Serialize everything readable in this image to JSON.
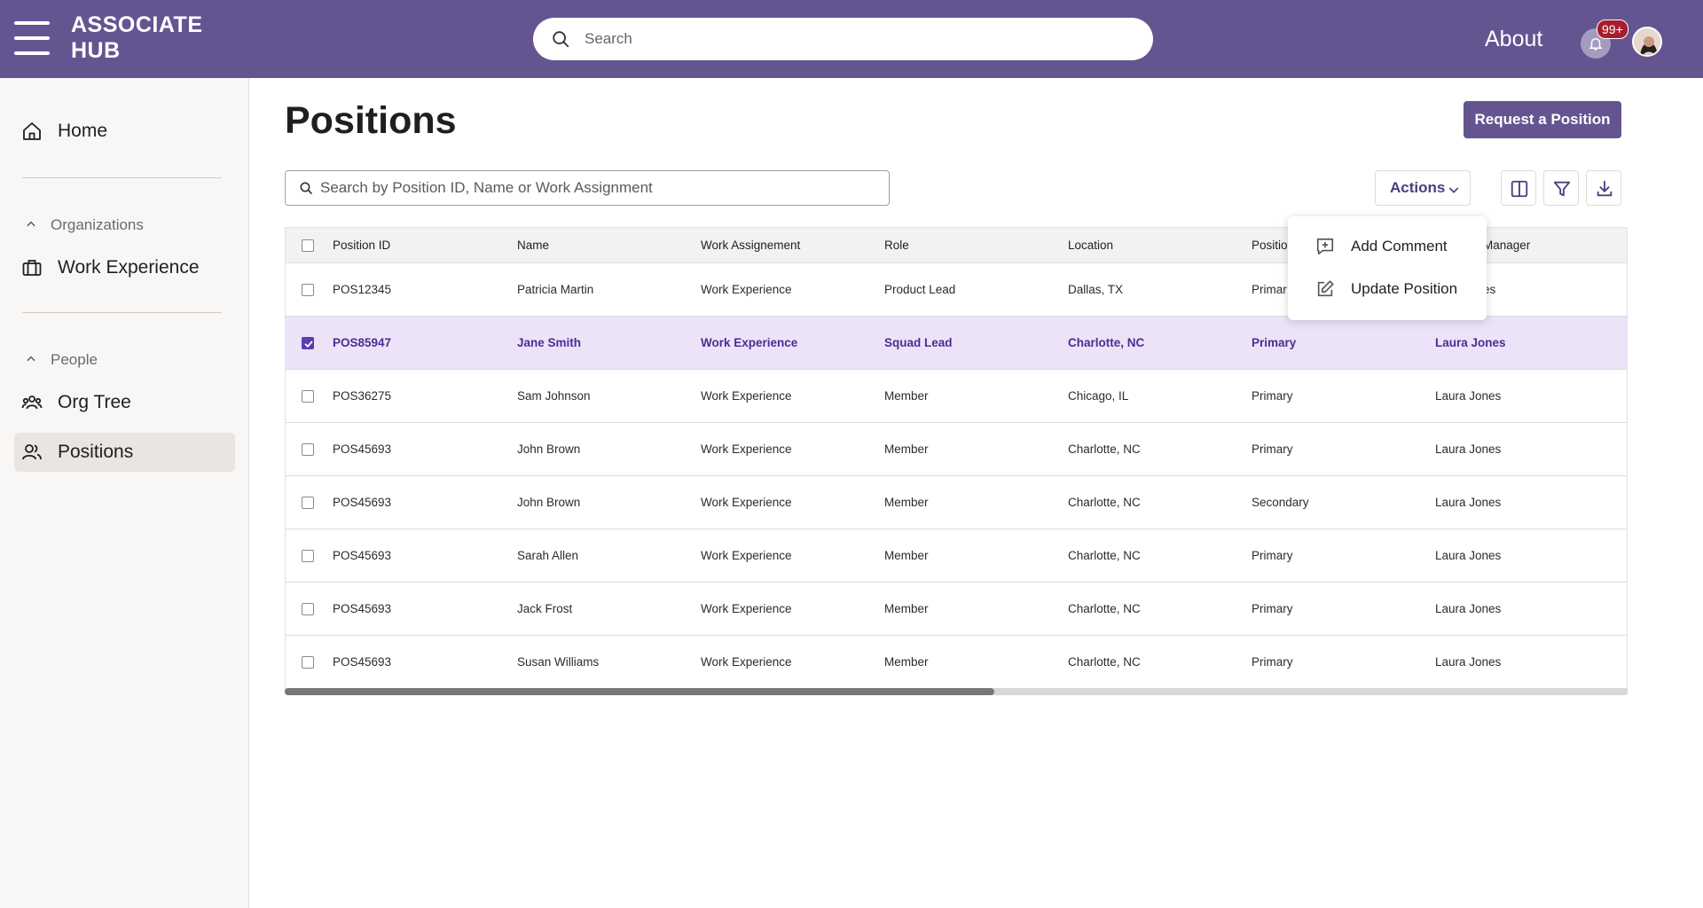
{
  "header": {
    "brand_line1": "ASSOCIATE",
    "brand_line2": "HUB",
    "search_placeholder": "Search",
    "about_label": "About",
    "notification_count": "99+"
  },
  "sidebar": {
    "home_label": "Home",
    "section_organizations": "Organizations",
    "work_experience_label": "Work Experience",
    "section_people": "People",
    "org_tree_label": "Org Tree",
    "positions_label": "Positions"
  },
  "main": {
    "title": "Positions",
    "request_button": "Request a Position",
    "table_search_placeholder": "Search by Position ID, Name or Work Assignment",
    "actions_label": "Actions"
  },
  "actions_menu": {
    "add_comment": "Add Comment",
    "update_position": "Update Position"
  },
  "table": {
    "headers": {
      "position_id": "Position ID",
      "name": "Name",
      "work_assignment": "Work Assignement",
      "role": "Role",
      "location": "Location",
      "position_type": "Positio",
      "manager": "Manager"
    },
    "rows": [
      {
        "id": "POS12345",
        "name": "Patricia Martin",
        "work": "Work Experience",
        "role": "Product Lead",
        "location": "Dallas, TX",
        "position_type": "Primar",
        "manager": "es"
      },
      {
        "id": "POS85947",
        "name": "Jane Smith",
        "work": "Work Experience",
        "role": "Squad Lead",
        "location": "Charlotte, NC",
        "position_type": "Primary",
        "manager": "Laura Jones"
      },
      {
        "id": "POS36275",
        "name": "Sam Johnson",
        "work": "Work Experience",
        "role": "Member",
        "location": "Chicago, IL",
        "position_type": "Primary",
        "manager": "Laura Jones"
      },
      {
        "id": "POS45693",
        "name": "John Brown",
        "work": "Work Experience",
        "role": "Member",
        "location": "Charlotte, NC",
        "position_type": "Primary",
        "manager": "Laura Jones"
      },
      {
        "id": "POS45693",
        "name": "John Brown",
        "work": "Work Experience",
        "role": "Member",
        "location": "Charlotte, NC",
        "position_type": "Secondary",
        "manager": "Laura Jones"
      },
      {
        "id": "POS45693",
        "name": "Sarah Allen",
        "work": "Work Experience",
        "role": "Member",
        "location": "Charlotte, NC",
        "position_type": "Primary",
        "manager": "Laura Jones"
      },
      {
        "id": "POS45693",
        "name": "Jack Frost",
        "work": "Work Experience",
        "role": "Member",
        "location": "Charlotte, NC",
        "position_type": "Primary",
        "manager": "Laura Jones"
      },
      {
        "id": "POS45693",
        "name": "Susan Williams",
        "work": "Work Experience",
        "role": "Member",
        "location": "Charlotte, NC",
        "position_type": "Primary",
        "manager": "Laura Jones"
      }
    ],
    "selected_row": 1
  },
  "colors": {
    "header_bg": "#645591",
    "accent": "#645591",
    "selected_row_bg": "#ece3f9",
    "selected_text": "#4b2d91",
    "badge": "#a51e2d"
  },
  "icons": [
    "menu-icon",
    "search-icon",
    "bell-icon",
    "home-icon",
    "chevron-up-icon",
    "briefcase-icon",
    "org-tree-icon",
    "people-icon",
    "chevron-down-icon",
    "columns-icon",
    "filter-icon",
    "download-icon",
    "add-comment-icon",
    "edit-icon",
    "check-icon"
  ]
}
